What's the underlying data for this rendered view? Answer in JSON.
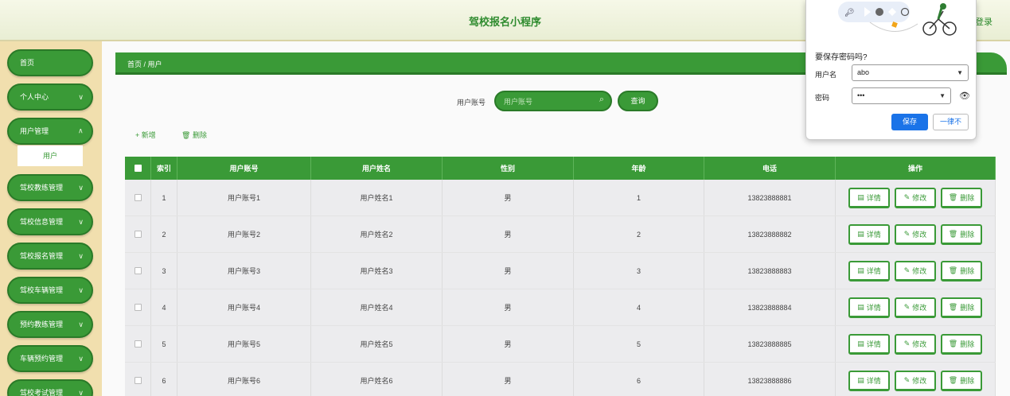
{
  "header": {
    "title": "驾校报名小程序",
    "login": "登录"
  },
  "sidebar": {
    "items": [
      {
        "label": "首页"
      },
      {
        "label": "个人中心"
      },
      {
        "label": "用户管理"
      },
      {
        "label": "驾校教练管理"
      },
      {
        "label": "驾校信息管理"
      },
      {
        "label": "驾校报名管理"
      },
      {
        "label": "驾校车辆管理"
      },
      {
        "label": "预约教练管理"
      },
      {
        "label": "车辆预约管理"
      },
      {
        "label": "驾校考试管理"
      }
    ],
    "sub_item": "用户",
    "chevron": "∨"
  },
  "breadcrumb": "首页 / 用户",
  "search": {
    "label": "用户账号",
    "placeholder": "用户账号",
    "button": "查询"
  },
  "toolbar": {
    "add": "+ 新增",
    "delete": "删除"
  },
  "table": {
    "headers": [
      "索引",
      "用户账号",
      "用户姓名",
      "性别",
      "年龄",
      "电话",
      "操作"
    ],
    "rows": [
      {
        "idx": "1",
        "account": "用户账号1",
        "name": "用户姓名1",
        "sex": "男",
        "age": "1",
        "tel": "13823888881"
      },
      {
        "idx": "2",
        "account": "用户账号2",
        "name": "用户姓名2",
        "sex": "男",
        "age": "2",
        "tel": "13823888882"
      },
      {
        "idx": "3",
        "account": "用户账号3",
        "name": "用户姓名3",
        "sex": "男",
        "age": "3",
        "tel": "13823888883"
      },
      {
        "idx": "4",
        "account": "用户账号4",
        "name": "用户姓名4",
        "sex": "男",
        "age": "4",
        "tel": "13823888884"
      },
      {
        "idx": "5",
        "account": "用户账号5",
        "name": "用户姓名5",
        "sex": "男",
        "age": "5",
        "tel": "13823888885"
      },
      {
        "idx": "6",
        "account": "用户账号6",
        "name": "用户姓名6",
        "sex": "男",
        "age": "6",
        "tel": "13823888886"
      }
    ],
    "ops": {
      "detail": "详情",
      "edit": "修改",
      "delete": "删除"
    }
  },
  "password_popup": {
    "title": "要保存密码吗?",
    "username_label": "用户名",
    "username_value": "abo",
    "password_label": "密码",
    "password_value": "•••",
    "save": "保存",
    "never": "一律不"
  },
  "colors": {
    "accent": "#3a9a37",
    "sidebar_bg": "#f1dfae",
    "popup_primary": "#1a73e8"
  }
}
